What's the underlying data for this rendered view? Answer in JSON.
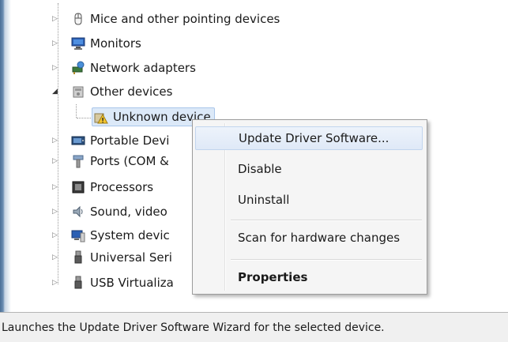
{
  "tree": {
    "items": [
      {
        "label": "Mice and other pointing devices",
        "icon": "mouse-icon"
      },
      {
        "label": "Monitors",
        "icon": "monitor-icon"
      },
      {
        "label": "Network adapters",
        "icon": "network-adapter-icon"
      },
      {
        "label": "Other devices",
        "icon": "other-devices-icon",
        "expanded": true
      },
      {
        "label": "Unknown device",
        "icon": "warning-device-icon",
        "selected": true
      },
      {
        "label": "Portable Devi",
        "icon": "portable-device-icon"
      },
      {
        "label": "Ports (COM &",
        "icon": "port-icon"
      },
      {
        "label": "Processors",
        "icon": "processor-icon"
      },
      {
        "label": "Sound, video",
        "icon": "speaker-icon"
      },
      {
        "label": "System devic",
        "icon": "system-device-icon"
      },
      {
        "label": "Universal Seri",
        "icon": "usb-icon"
      },
      {
        "label": "USB Virtualiza",
        "icon": "usb-icon"
      }
    ]
  },
  "context_menu": {
    "update_driver": "Update Driver Software...",
    "disable": "Disable",
    "uninstall": "Uninstall",
    "scan": "Scan for hardware changes",
    "properties": "Properties"
  },
  "status_bar": {
    "text": "Launches the Update Driver Software Wizard for the selected device."
  }
}
